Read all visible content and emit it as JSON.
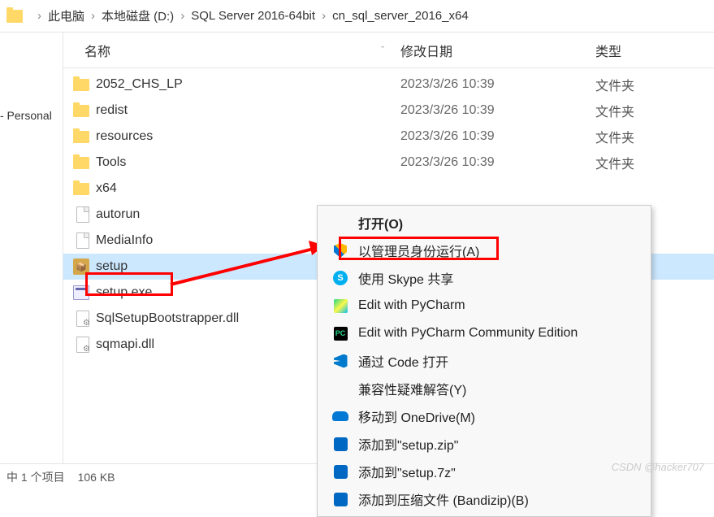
{
  "breadcrumb": {
    "items": [
      "此电脑",
      "本地磁盘 (D:)",
      "SQL Server 2016-64bit",
      "cn_sql_server_2016_x64"
    ]
  },
  "sidebar": {
    "items": [
      {
        "label": "- Personal"
      }
    ]
  },
  "headers": {
    "name": "名称",
    "date": "修改日期",
    "type": "类型"
  },
  "files": [
    {
      "icon": "folder",
      "name": "2052_CHS_LP",
      "date": "2023/3/26 10:39",
      "type": "文件夹"
    },
    {
      "icon": "folder",
      "name": "redist",
      "date": "2023/3/26 10:39",
      "type": "文件夹"
    },
    {
      "icon": "folder",
      "name": "resources",
      "date": "2023/3/26 10:39",
      "type": "文件夹"
    },
    {
      "icon": "folder",
      "name": "Tools",
      "date": "2023/3/26 10:39",
      "type": "文件夹"
    },
    {
      "icon": "folder",
      "name": "x64",
      "date": "",
      "type": ""
    },
    {
      "icon": "file",
      "name": "autorun",
      "date": "",
      "type": ""
    },
    {
      "icon": "file",
      "name": "MediaInfo",
      "date": "",
      "type": ""
    },
    {
      "icon": "setup",
      "name": "setup",
      "date": "",
      "type": "",
      "selected": true
    },
    {
      "icon": "exe",
      "name": "setup.exe",
      "date": "",
      "type": ""
    },
    {
      "icon": "dll",
      "name": "SqlSetupBootstrapper.dll",
      "date": "",
      "type": ""
    },
    {
      "icon": "dll",
      "name": "sqmapi.dll",
      "date": "",
      "type": ""
    }
  ],
  "context_menu": {
    "items": [
      {
        "icon": "",
        "label": "打开(O)",
        "bold": true
      },
      {
        "icon": "shield",
        "label": "以管理员身份运行(A)"
      },
      {
        "icon": "skype",
        "label": "使用 Skype 共享"
      },
      {
        "icon": "pycharm",
        "label": "Edit with PyCharm"
      },
      {
        "icon": "pycharm-ce",
        "label": "Edit with PyCharm Community Edition"
      },
      {
        "icon": "vscode",
        "label": "通过 Code 打开"
      },
      {
        "icon": "",
        "label": "兼容性疑难解答(Y)"
      },
      {
        "icon": "onedrive",
        "label": "移动到 OneDrive(M)"
      },
      {
        "icon": "bandizip",
        "label": "添加到\"setup.zip\""
      },
      {
        "icon": "bandizip",
        "label": "添加到\"setup.7z\""
      },
      {
        "icon": "bandizip",
        "label": "添加到压缩文件 (Bandizip)(B)"
      }
    ]
  },
  "statusbar": {
    "selection": "中 1 个项目",
    "size": "106 KB"
  },
  "watermark": "CSDN @hacker707"
}
